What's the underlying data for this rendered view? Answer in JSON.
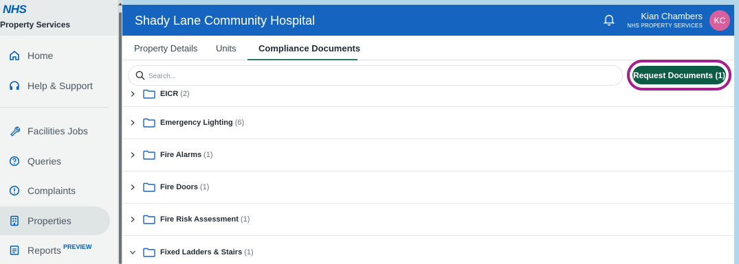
{
  "sidebar": {
    "brand_logo": "NHS",
    "brand_sub": "Property Services",
    "items": [
      {
        "label": "Home",
        "icon": "home-icon"
      },
      {
        "label": "Help & Support",
        "icon": "headset-icon"
      },
      {
        "label": "Facilities Jobs",
        "icon": "wrench-icon"
      },
      {
        "label": "Queries",
        "icon": "question-icon"
      },
      {
        "label": "Complaints",
        "icon": "alert-icon"
      },
      {
        "label": "Properties",
        "icon": "building-icon"
      },
      {
        "label": "Reports",
        "icon": "report-icon",
        "badge": "PREVIEW"
      }
    ],
    "active_item": "Properties"
  },
  "header": {
    "title": "Shady Lane Community Hospital",
    "user_name": "Kian Chambers",
    "user_org": "NHS PROPERTY SERVICES",
    "avatar_initials": "KC"
  },
  "tabs": [
    {
      "label": "Property Details"
    },
    {
      "label": "Units"
    },
    {
      "label": "Compliance Documents"
    }
  ],
  "active_tab": "Compliance Documents",
  "search": {
    "placeholder": "Search..."
  },
  "request_button": {
    "label": "Request Documents (1)"
  },
  "folders": [
    {
      "name": "EICR",
      "count": "(2)",
      "expanded": false
    },
    {
      "name": "Emergency Lighting",
      "count": "(6)",
      "expanded": false
    },
    {
      "name": "Fire Alarms",
      "count": "(1)",
      "expanded": false
    },
    {
      "name": "Fire Doors",
      "count": "(1)",
      "expanded": false
    },
    {
      "name": "Fire Risk Assessment",
      "count": "(1)",
      "expanded": false
    },
    {
      "name": "Fixed Ladders & Stairs",
      "count": "(1)",
      "expanded": true
    }
  ],
  "colors": {
    "header": "#1565c0",
    "request_button": "#0b5b45",
    "highlight_ring": "#a3208d",
    "avatar": "#d8609f",
    "accent_icon": "#005eb8"
  }
}
